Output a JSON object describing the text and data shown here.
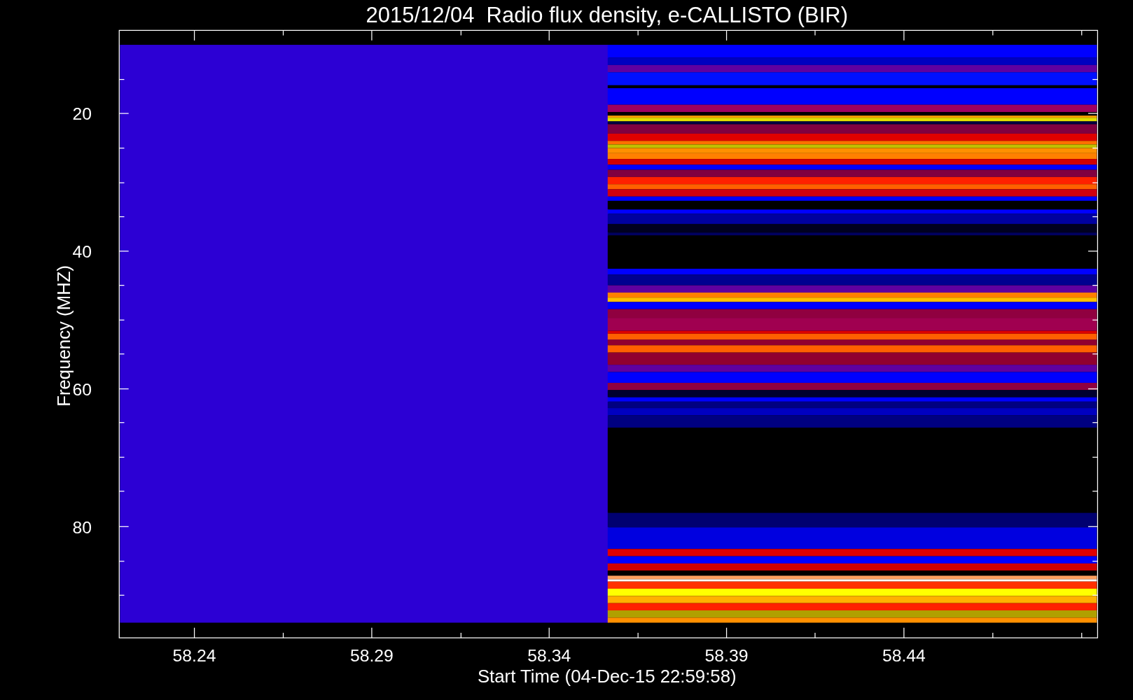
{
  "title": "2015/12/04  Radio flux density, e-CALLISTO (BIR)",
  "x_axis": {
    "label": "Start Time (04-Dec-15 22:59:58)",
    "ticks": [
      "58.24",
      "58.29",
      "58.34",
      "58.39",
      "58.44"
    ]
  },
  "y_axis": {
    "label": "Frequency (MHZ)",
    "ticks": [
      "20",
      "40",
      "60",
      "80"
    ]
  }
}
